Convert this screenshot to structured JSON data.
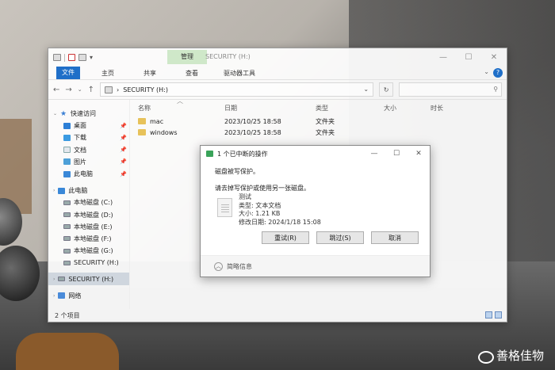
{
  "explorer": {
    "title": "SECURITY (H:)",
    "manage_tab": "管理",
    "ribbon_tabs": [
      "文件",
      "主页",
      "共享",
      "查看",
      "驱动器工具"
    ],
    "address": "SECURITY (H:)",
    "nav": {
      "quick_access": "快速访问",
      "quick_items": [
        "桌面",
        "下载",
        "文档",
        "图片",
        "此电脑"
      ],
      "this_pc": "此电脑",
      "drives": [
        "本地磁盘 (C:)",
        "本地磁盘 (D:)",
        "本地磁盘 (E:)",
        "本地磁盘 (F:)",
        "本地磁盘 (G:)",
        "SECURITY (H:)"
      ],
      "security_sel": "SECURITY (H:)",
      "network": "网络"
    },
    "columns": [
      "名称",
      "日期",
      "类型",
      "大小",
      "时长"
    ],
    "files": [
      {
        "name": "mac",
        "date": "2023/10/25 18:58",
        "type": "文件夹"
      },
      {
        "name": "windows",
        "date": "2023/10/25 18:58",
        "type": "文件夹"
      }
    ],
    "status": "2 个项目"
  },
  "dialog": {
    "title": "1 个已中断的操作",
    "message1": "磁盘被写保护。",
    "message2": "请去掉写保护或使用另一张磁盘。",
    "file_name": "测试",
    "file_type": "类型: 文本文档",
    "file_size": "大小: 1.21 KB",
    "file_modified": "修改日期: 2024/1/18 15:08",
    "retry": "重试(R)",
    "skip": "跳过(S)",
    "cancel": "取消",
    "details": "简略信息"
  },
  "watermark": "善格佳物"
}
